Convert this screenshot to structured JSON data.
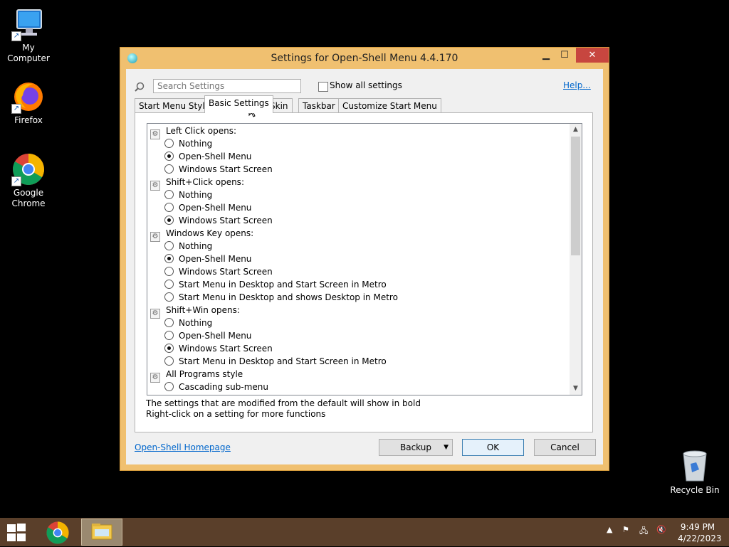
{
  "desktop": {
    "icons": [
      {
        "label": "My Computer"
      },
      {
        "label": "Firefox"
      },
      {
        "label": "Google Chrome"
      },
      {
        "label": "Recycle Bin"
      }
    ]
  },
  "window": {
    "title": "Settings for Open-Shell Menu 4.4.170",
    "search_placeholder": "Search Settings",
    "show_all_label": "Show all settings",
    "show_all_checked": false,
    "help_label": "Help...",
    "tabs": [
      {
        "label": "Start Menu Style",
        "active": false
      },
      {
        "label": "Basic Settings",
        "active": true
      },
      {
        "label": "Skin",
        "active": false
      },
      {
        "label": "Taskbar",
        "active": false
      },
      {
        "label": "Customize Start Menu",
        "active": false
      }
    ],
    "settings": [
      {
        "type": "group",
        "label": "Left Click opens:"
      },
      {
        "type": "option",
        "label": "Nothing",
        "selected": false
      },
      {
        "type": "option",
        "label": "Open-Shell Menu",
        "selected": true
      },
      {
        "type": "option",
        "label": "Windows Start Screen",
        "selected": false
      },
      {
        "type": "group",
        "label": "Shift+Click opens:"
      },
      {
        "type": "option",
        "label": "Nothing",
        "selected": false
      },
      {
        "type": "option",
        "label": "Open-Shell Menu",
        "selected": false
      },
      {
        "type": "option",
        "label": "Windows Start Screen",
        "selected": true
      },
      {
        "type": "group",
        "label": "Windows Key opens:"
      },
      {
        "type": "option",
        "label": "Nothing",
        "selected": false
      },
      {
        "type": "option",
        "label": "Open-Shell Menu",
        "selected": true
      },
      {
        "type": "option",
        "label": "Windows Start Screen",
        "selected": false
      },
      {
        "type": "option",
        "label": "Start Menu in Desktop and Start Screen in Metro",
        "selected": false
      },
      {
        "type": "option",
        "label": "Start Menu in Desktop and shows Desktop in Metro",
        "selected": false
      },
      {
        "type": "group",
        "label": "Shift+Win opens:"
      },
      {
        "type": "option",
        "label": "Nothing",
        "selected": false
      },
      {
        "type": "option",
        "label": "Open-Shell Menu",
        "selected": false
      },
      {
        "type": "option",
        "label": "Windows Start Screen",
        "selected": true
      },
      {
        "type": "option",
        "label": "Start Menu in Desktop and Start Screen in Metro",
        "selected": false
      },
      {
        "type": "group",
        "label": "All Programs style"
      },
      {
        "type": "option",
        "label": "Cascading sub-menu",
        "selected": false
      }
    ],
    "info_line1": "The settings that are modified from the default will show in bold",
    "info_line2": "Right-click on a setting for more functions",
    "homepage_link": "Open-Shell Homepage",
    "backup_label": "Backup",
    "ok_label": "OK",
    "cancel_label": "Cancel"
  },
  "taskbar": {
    "time": "9:49 PM",
    "date": "4/22/2023"
  },
  "colors": {
    "window_frame": "#f0c070",
    "close_button": "#c7463f",
    "taskbar": "#5a3f2a",
    "link": "#0066cc"
  }
}
